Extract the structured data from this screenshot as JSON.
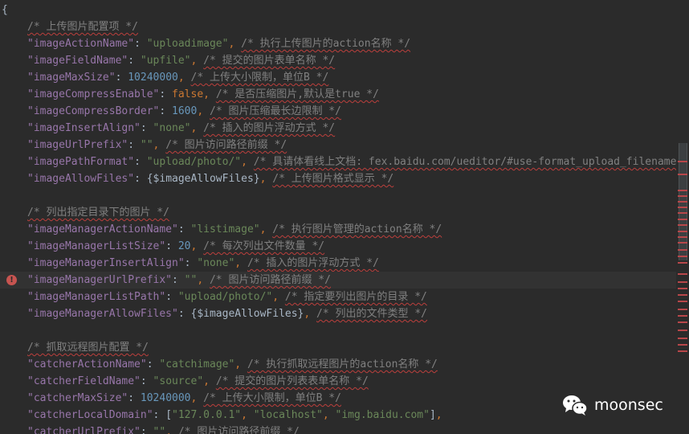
{
  "editor": {
    "error_icon_glyph": "!",
    "watermark_text": "moonsec",
    "colors": {
      "background": "#2b2b2b",
      "key": "#9876aa",
      "string": "#6a8759",
      "number": "#6897bb",
      "keyword": "#cc7832",
      "comment": "#808080",
      "error": "#c75450"
    },
    "lines": [
      [
        [
          "t",
          "{"
        ]
      ],
      [
        [
          "c",
          "/* 上传图片配置项 */",
          1
        ]
      ],
      [
        [
          "k",
          "\"imageActionName\""
        ],
        [
          "t",
          ": "
        ],
        [
          "s",
          "\"uploadimage\""
        ],
        [
          "p",
          ", "
        ],
        [
          "c",
          "/* 执行上传图片的action名称 */",
          1
        ]
      ],
      [
        [
          "k",
          "\"imageFieldName\""
        ],
        [
          "t",
          ": "
        ],
        [
          "s",
          "\"upfile\""
        ],
        [
          "p",
          ", "
        ],
        [
          "c",
          "/* 提交的图片表单名称 */",
          1
        ]
      ],
      [
        [
          "k",
          "\"imageMaxSize\""
        ],
        [
          "t",
          ": "
        ],
        [
          "n",
          "10240000"
        ],
        [
          "p",
          ", "
        ],
        [
          "c",
          "/* 上传大小限制，单位B */",
          1
        ]
      ],
      [
        [
          "k",
          "\"imageCompressEnable\""
        ],
        [
          "t",
          ": "
        ],
        [
          "kw",
          "false"
        ],
        [
          "p",
          ", "
        ],
        [
          "c",
          "/* 是否压缩图片,默认是true */",
          1
        ]
      ],
      [
        [
          "k",
          "\"imageCompressBorder\""
        ],
        [
          "t",
          ": "
        ],
        [
          "n",
          "1600"
        ],
        [
          "p",
          ", "
        ],
        [
          "c",
          "/* 图片压缩最长边限制 */",
          1
        ]
      ],
      [
        [
          "k",
          "\"imageInsertAlign\""
        ],
        [
          "t",
          ": "
        ],
        [
          "s",
          "\"none\""
        ],
        [
          "p",
          ", "
        ],
        [
          "c",
          "/* 插入的图片浮动方式 */",
          1
        ]
      ],
      [
        [
          "k",
          "\"imageUrlPrefix\""
        ],
        [
          "t",
          ": "
        ],
        [
          "s",
          "\"\""
        ],
        [
          "p",
          ", "
        ],
        [
          "c",
          "/* 图片访问路径前缀 */",
          1
        ]
      ],
      [
        [
          "k",
          "\"imagePathFormat\""
        ],
        [
          "t",
          ": "
        ],
        [
          "s",
          "\"upload/photo/\""
        ],
        [
          "p",
          ", "
        ],
        [
          "c",
          "/* 具请体看线上文档: fex.baidu.com/ueditor/#use-format_upload_filename */",
          1
        ]
      ],
      [
        [
          "k",
          "\"imageAllowFiles\""
        ],
        [
          "t",
          ": "
        ],
        [
          "v",
          "{$imageAllowFiles}"
        ],
        [
          "p",
          ", "
        ],
        [
          "c",
          "/* 上传图片格式显示 */",
          1
        ]
      ],
      [],
      [
        [
          "c",
          "/* 列出指定目录下的图片 */",
          1
        ]
      ],
      [
        [
          "k",
          "\"imageManagerActionName\""
        ],
        [
          "t",
          ": "
        ],
        [
          "s",
          "\"listimage\""
        ],
        [
          "p",
          ", "
        ],
        [
          "c",
          "/* 执行图片管理的action名称 */",
          1
        ]
      ],
      [
        [
          "k",
          "\"imageManagerListSize\""
        ],
        [
          "t",
          ": "
        ],
        [
          "n",
          "20"
        ],
        [
          "p",
          ", "
        ],
        [
          "c",
          "/* 每次列出文件数量 */",
          1
        ]
      ],
      [
        [
          "k",
          "\"imageManagerInsertAlign\""
        ],
        [
          "t",
          ": "
        ],
        [
          "s",
          "\"none\""
        ],
        [
          "p",
          ", "
        ],
        [
          "c",
          "/* 插入的图片浮动方式 */",
          1
        ]
      ],
      [
        [
          "k",
          "\"imageManagerUrlPrefix\""
        ],
        [
          "t",
          ": "
        ],
        [
          "s",
          "\"\""
        ],
        [
          "p",
          ", "
        ],
        [
          "c",
          "/* 图片访问路径前缀 */",
          1
        ]
      ],
      [
        [
          "k",
          "\"imageManagerListPath\""
        ],
        [
          "t",
          ": "
        ],
        [
          "s",
          "\"upload/photo/\""
        ],
        [
          "p",
          ", "
        ],
        [
          "c",
          "/* 指定要列出图片的目录 */",
          1
        ]
      ],
      [
        [
          "k",
          "\"imageManagerAllowFiles\""
        ],
        [
          "t",
          ": "
        ],
        [
          "v",
          "{$imageAllowFiles}"
        ],
        [
          "p",
          ", "
        ],
        [
          "c",
          "/* 列出的文件类型 */",
          1
        ]
      ],
      [],
      [
        [
          "c",
          "/* 抓取远程图片配置 */",
          1
        ]
      ],
      [
        [
          "k",
          "\"catcherActionName\""
        ],
        [
          "t",
          ": "
        ],
        [
          "s",
          "\"catchimage\""
        ],
        [
          "p",
          ", "
        ],
        [
          "c",
          "/* 执行抓取远程图片的action名称 */",
          1
        ]
      ],
      [
        [
          "k",
          "\"catcherFieldName\""
        ],
        [
          "t",
          ": "
        ],
        [
          "s",
          "\"source\""
        ],
        [
          "p",
          ", "
        ],
        [
          "c",
          "/* 提交的图片列表表单名称 */",
          1
        ]
      ],
      [
        [
          "k",
          "\"catcherMaxSize\""
        ],
        [
          "t",
          ": "
        ],
        [
          "n",
          "10240000"
        ],
        [
          "p",
          ", "
        ],
        [
          "c",
          "/* 上传大小限制，单位B */",
          1
        ]
      ],
      [
        [
          "k",
          "\"catcherLocalDomain\""
        ],
        [
          "t",
          ": "
        ],
        [
          "t",
          "["
        ],
        [
          "s",
          "\"127.0.0.1\""
        ],
        [
          "p",
          ", "
        ],
        [
          "s",
          "\"localhost\""
        ],
        [
          "p",
          ", "
        ],
        [
          "s",
          "\"img.baidu.com\""
        ],
        [
          "t",
          "]"
        ],
        [
          "p",
          ","
        ]
      ],
      [
        [
          "k",
          "\"catcherUrlPrefix\""
        ],
        [
          "t",
          ": "
        ],
        [
          "s",
          "\"\""
        ],
        [
          "p",
          ", "
        ],
        [
          "c",
          "/* 图片访问路径前缀 */",
          1
        ]
      ]
    ]
  }
}
